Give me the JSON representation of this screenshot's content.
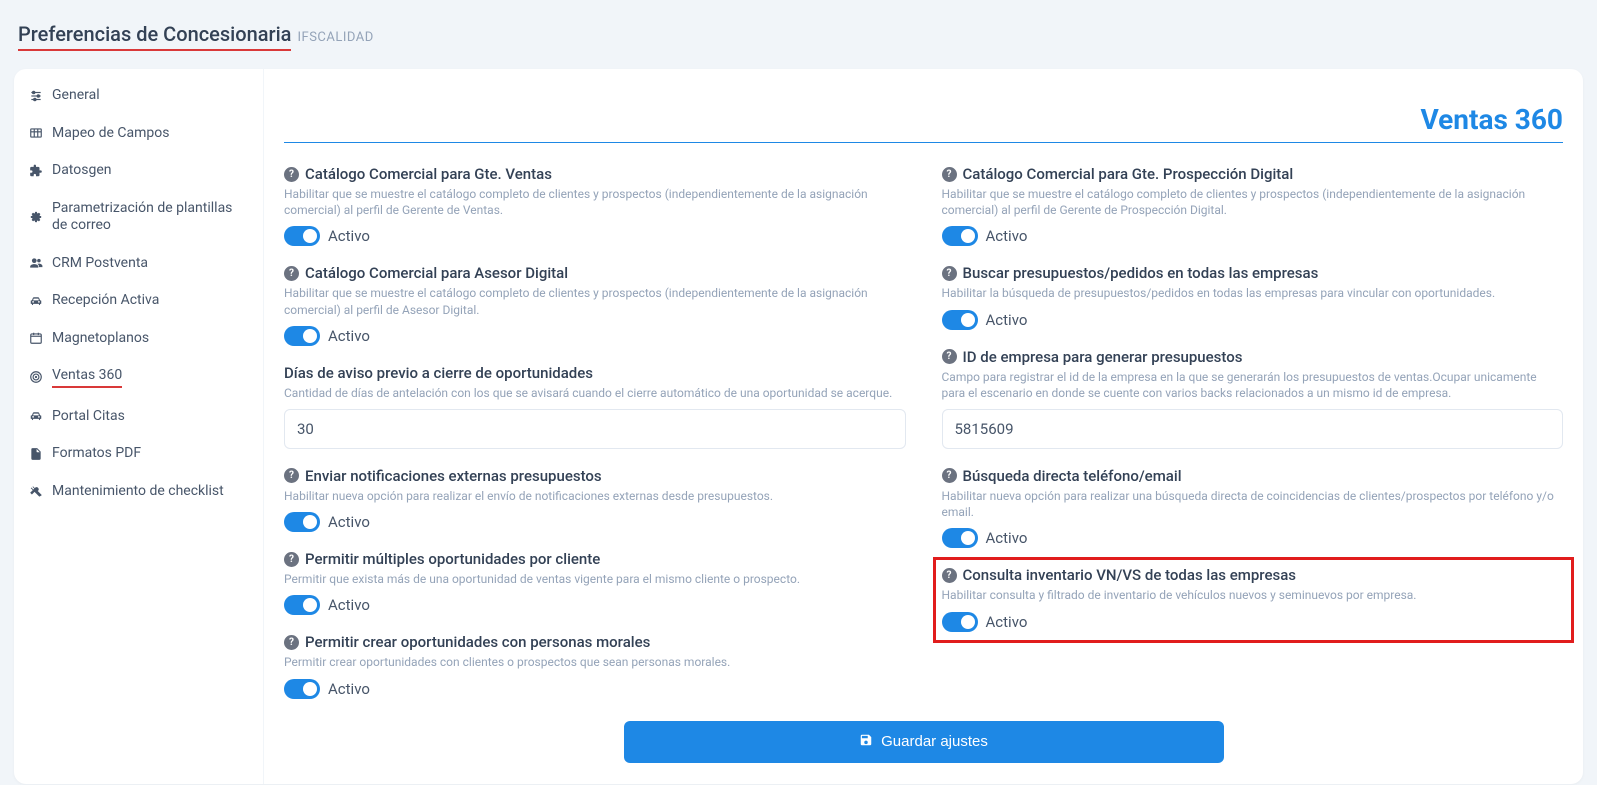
{
  "header": {
    "title": "Preferencias de Concesionaria",
    "subtitle": "IFSCALIDAD"
  },
  "sidebar": {
    "items": [
      {
        "icon": "sliders",
        "label": "General"
      },
      {
        "icon": "table",
        "label": "Mapeo de Campos"
      },
      {
        "icon": "puzzle",
        "label": "Datosgen"
      },
      {
        "icon": "gears",
        "label": "Parametrización de plantillas de correo"
      },
      {
        "icon": "users",
        "label": "CRM Postventa"
      },
      {
        "icon": "car",
        "label": "Recepción Activa"
      },
      {
        "icon": "calendar",
        "label": "Magnetoplanos"
      },
      {
        "icon": "target",
        "label": "Ventas 360",
        "active": true
      },
      {
        "icon": "car",
        "label": "Portal Citas"
      },
      {
        "icon": "file",
        "label": "Formatos PDF"
      },
      {
        "icon": "tools",
        "label": "Mantenimiento de checklist"
      }
    ]
  },
  "section": {
    "title": "Ventas 360"
  },
  "left": [
    {
      "title": "Catálogo Comercial para Gte. Ventas",
      "desc": "Habilitar que se muestre el catálogo completo de clientes y prospectos (independientemente de la asignación comercial) al perfil de Gerente de Ventas.",
      "toggle_label": "Activo"
    },
    {
      "title": "Catálogo Comercial para Asesor Digital",
      "desc": "Habilitar que se muestre el catálogo completo de clientes y prospectos (independientemente de la asignación comercial) al perfil de Asesor Digital.",
      "toggle_label": "Activo"
    },
    {
      "title": "Días de aviso previo a cierre de oportunidades",
      "desc": "Cantidad de días de antelación con los que se avisará cuando el cierre automático de una oportunidad se acerque.",
      "input_value": "30"
    },
    {
      "title": "Enviar notificaciones externas presupuestos",
      "desc": "Habilitar nueva opción para realizar el envío de notificaciones externas desde presupuestos.",
      "toggle_label": "Activo"
    },
    {
      "title": "Permitir múltiples oportunidades por cliente",
      "desc": "Permitir que exista más de una oportunidad de ventas vigente para el mismo cliente o prospecto.",
      "toggle_label": "Activo"
    },
    {
      "title": "Permitir crear oportunidades con personas morales",
      "desc": "Permitir crear oportunidades con clientes o prospectos que sean personas morales.",
      "toggle_label": "Activo"
    }
  ],
  "right": [
    {
      "title": "Catálogo Comercial para Gte. Prospección Digital",
      "desc": "Habilitar que se muestre el catálogo completo de clientes y prospectos (independientemente de la asignación comercial) al perfil de Gerente de Prospección Digital.",
      "toggle_label": "Activo"
    },
    {
      "title": "Buscar presupuestos/pedidos en todas las empresas",
      "desc": "Habilitar la búsqueda de presupuestos/pedidos en todas las empresas para vincular con oportunidades.",
      "toggle_label": "Activo"
    },
    {
      "title": "ID de empresa para generar presupuestos",
      "desc": "Campo para registrar el id de la empresa en la que se generarán los presupuestos de ventas.Ocupar unicamente para el escenario en donde se cuente con varios backs relacionados a un mismo id de empresa.",
      "input_value": "5815609"
    },
    {
      "title": "Búsqueda directa teléfono/email",
      "desc": "Habilitar nueva opción para realizar una búsqueda directa de coincidencias de clientes/prospectos por teléfono y/o email.",
      "toggle_label": "Activo"
    },
    {
      "title": "Consulta inventario VN/VS de todas las empresas",
      "desc": "Habilitar consulta y filtrado de inventario de vehículos nuevos y seminuevos por empresa.",
      "toggle_label": "Activo",
      "highlight": true
    }
  ],
  "save_label": "Guardar ajustes"
}
